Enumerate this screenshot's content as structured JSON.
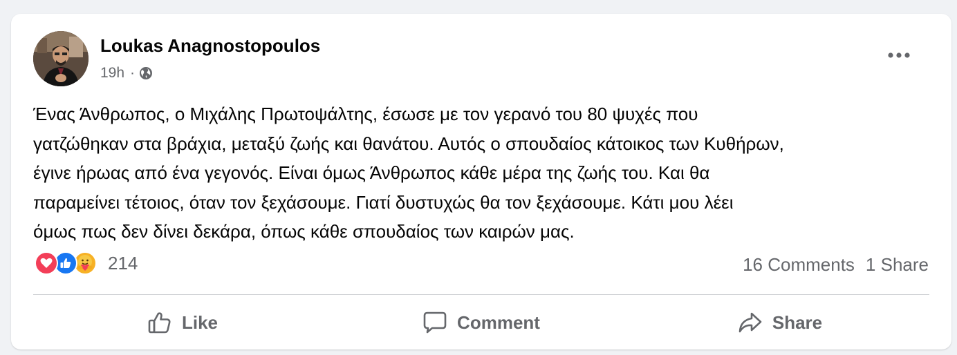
{
  "post": {
    "author_name": "Loukas Anagnostopoulos",
    "time": "19h",
    "separator": "·",
    "privacy_icon": "globe-icon",
    "text_lines": [
      "Ένας Άνθρωπος, ο Μιχάλης Πρωτοψάλτης, έσωσε με τον γερανό του 80 ψυχές που",
      "γατζώθηκαν στα βράχια, μεταξύ ζωής και θανάτου. Αυτός ο σπουδαίος κάτοικος των Κυθήρων,",
      "έγινε ήρωας από ένα γεγονός. Είναι όμως Άνθρωπος κάθε μέρα της ζωής του. Και θα",
      "παραμείνει τέτοιος, όταν τον ξεχάσουμε. Γιατί δυστυχώς θα τον ξεχάσουμε. Κάτι μου λέει",
      "όμως πως δεν δίνει δεκάρα, όπως κάθε σπουδαίος των καιρών μας."
    ]
  },
  "reactions": {
    "icons": [
      "love-icon",
      "like-icon",
      "care-icon"
    ],
    "count": "214"
  },
  "stats": {
    "comments": "16 Comments",
    "shares": "1 Share"
  },
  "actions": {
    "like_label": "Like",
    "comment_label": "Comment",
    "share_label": "Share"
  },
  "colors": {
    "background": "#f0f2f5",
    "card": "#ffffff",
    "text_primary": "#050505",
    "text_secondary": "#65676b",
    "divider": "#ced0d4",
    "love": "#f33e58",
    "like": "#1877f2",
    "care": "#f7b125"
  }
}
